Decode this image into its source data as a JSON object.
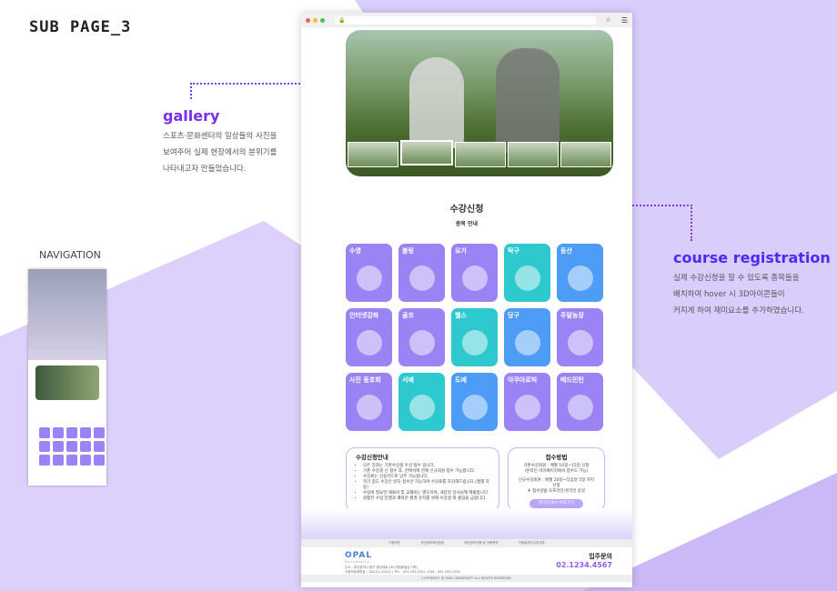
{
  "page_title": "SUB PAGE_3",
  "navigation_label": "NAVIGATION",
  "gallery": {
    "heading": "gallery",
    "lines": [
      "스포츠·문화센터의 일상들의 사진을",
      "보여주어 실제 현장에서의 분위기를",
      "나타내고자 만들었습니다."
    ]
  },
  "course_registration": {
    "heading": "course registration",
    "lines": [
      "실제 수강신청을 할 수 있도록 종목들을",
      "배치하여 hover 시 3D아이콘들이",
      "커지게 하여 재미요소를 추가하였습니다."
    ]
  },
  "colors": {
    "accent": "#7a2ee8",
    "purple": "#9b83f5",
    "teal": "#2ec9cf",
    "blue": "#4d9cf5"
  },
  "site": {
    "section_title": "수강신청",
    "section_subtitle": "종목 안내",
    "courses": [
      {
        "label": "수영",
        "color": "#9b83f5",
        "icon": "goggles-icon"
      },
      {
        "label": "볼링",
        "color": "#9b83f5",
        "icon": "bowling-icon"
      },
      {
        "label": "요가",
        "color": "#9b83f5",
        "icon": "yoga-mat-icon"
      },
      {
        "label": "탁구",
        "color": "#2ec9cf",
        "icon": "ping-pong-icon"
      },
      {
        "label": "등산",
        "color": "#4d9cf5",
        "icon": "mountain-icon"
      },
      {
        "label": "인터넷강좌",
        "color": "#9b83f5",
        "icon": "computer-icon"
      },
      {
        "label": "골프",
        "color": "#9b83f5",
        "icon": "golf-icon"
      },
      {
        "label": "헬스",
        "color": "#2ec9cf",
        "icon": "treadmill-icon"
      },
      {
        "label": "당구",
        "color": "#4d9cf5",
        "icon": "billiard-ball-icon"
      },
      {
        "label": "주말농장",
        "color": "#9b83f5",
        "icon": "vegetables-icon"
      },
      {
        "label": "사진 동호회",
        "color": "#9b83f5",
        "icon": "camera-icon"
      },
      {
        "label": "서예",
        "color": "#2ec9cf",
        "icon": "brush-hand-icon"
      },
      {
        "label": "도예",
        "color": "#4d9cf5",
        "icon": "vase-icon"
      },
      {
        "label": "아쿠아로빅",
        "color": "#9b83f5",
        "icon": "goggles-icon"
      },
      {
        "label": "배드민턴",
        "color": "#9b83f5",
        "icon": "shuttlecock-icon"
      }
    ],
    "notice": {
      "title": "수강신청안내",
      "items": [
        "모든 강좌는 기존수강생 우선 접수 입니다.",
        "기존 수강생 신 접수 후, 잔여석에 한해 신규회원 접수 가능합니다.",
        "수강료는 신용카드로 납부 가능합니다.",
        "학기 중도 수강은 빈자 접수만 가능하며 수강료를 차감해드립니다.(월별 차등)",
        "수업에 필요한 재료비 및 교재비는 별도이며, 개강일 강사님께 제출합니다.",
        "원활한 수업 진행과 쾌적한 환경 유지를 위해 수강생 외 출입을 금합니다."
      ]
    },
    "method": {
      "title": "접수방법",
      "lines": [
        "기존수강회원 : 매월 10일~15일 신청",
        "(온라인 마이페이지에서 접수도 가능)",
        "신규수강회원 : 매월 20일~다음달 5일 까지 신청",
        "※ 접수방법 오프라인/온라인 동일"
      ],
      "button": "온라인에서 바로가기"
    },
    "footer_nav": [
      "이용약관",
      "개인정보처리방침",
      "개인정보이용 및 이용목적",
      "이메일무단수집거부"
    ],
    "logo": "OPAL",
    "logo_sub": "University",
    "address": [
      "주소 : 부산광역시 중구 중앙대로 26 (대청동빌딩 1층)",
      "사업자등록번호 : 126-01-22412 | TEL : 051-209-2241 | FAX : 051-209-2249"
    ],
    "inquiry_label": "입주문의",
    "inquiry_phone": "02.1234.4567",
    "copyright": "COPYRIGHT @ OPAL UNIVERSITY ALL RIGHTS RESERVED."
  }
}
